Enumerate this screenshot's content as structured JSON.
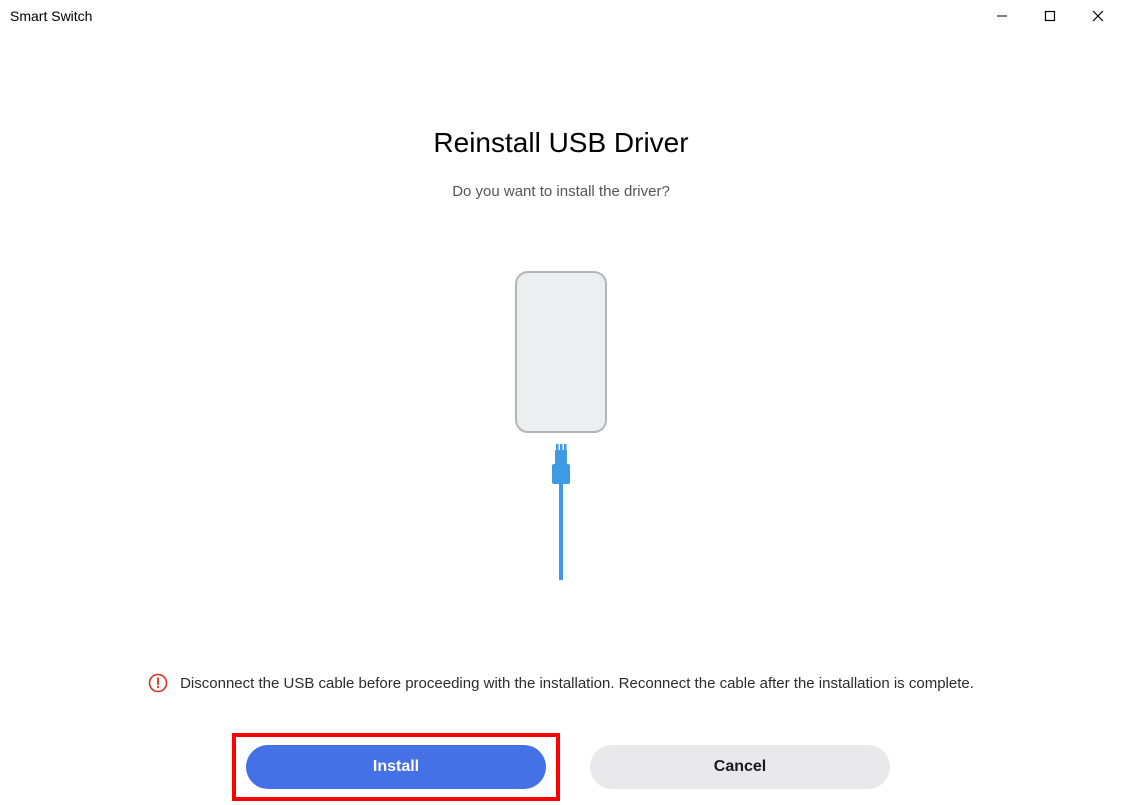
{
  "window": {
    "title": "Smart Switch"
  },
  "dialog": {
    "heading": "Reinstall USB Driver",
    "subtitle": "Do you want to install the driver?",
    "warning": "Disconnect the USB cable before proceeding with the installation. Reconnect the cable after the installation is complete."
  },
  "buttons": {
    "install": "Install",
    "cancel": "Cancel"
  }
}
